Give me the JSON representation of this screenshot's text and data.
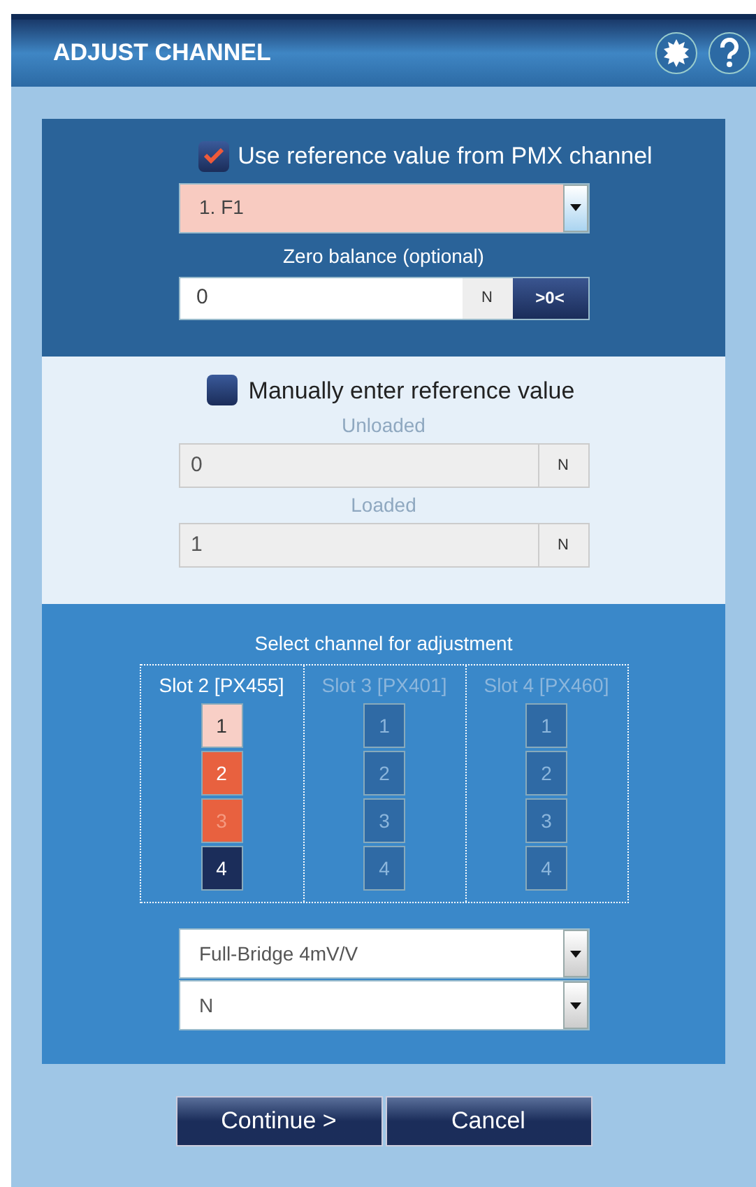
{
  "window": {
    "title": "ADJUST CHANNEL"
  },
  "pmx_section": {
    "checkbox": {
      "label": "Use reference value from PMX channel",
      "checked": true
    },
    "channel_select": {
      "value": "1. F1"
    },
    "zero_balance": {
      "label": "Zero balance (optional)",
      "value": "0",
      "unit": "N",
      "button": ">0<"
    }
  },
  "manual_section": {
    "checkbox": {
      "label": "Manually enter reference value",
      "checked": false
    },
    "fields": [
      {
        "label": "Unloaded",
        "value": "0",
        "unit": "N"
      },
      {
        "label": "Loaded",
        "value": "1",
        "unit": "N"
      }
    ]
  },
  "channel_section": {
    "title": "Select channel for adjustment",
    "slots": [
      {
        "label": "Slot 2 [PX455]",
        "disabled": false,
        "channels": [
          {
            "label": "1",
            "color": "#f8cfc6",
            "disabled": false
          },
          {
            "label": "2",
            "color": "#e8613f",
            "disabled": false
          },
          {
            "label": "3",
            "color": "#e8613f",
            "disabled": true
          },
          {
            "label": "4",
            "color": "#1b2d5a",
            "disabled": false
          }
        ]
      },
      {
        "label": "Slot 3 [PX401]",
        "disabled": true,
        "channels": [
          {
            "label": "1",
            "color": "#2f6aa5",
            "disabled": false
          },
          {
            "label": "2",
            "color": "#2f6aa5",
            "disabled": false
          },
          {
            "label": "3",
            "color": "#2f6aa5",
            "disabled": false
          },
          {
            "label": "4",
            "color": "#2f6aa5",
            "disabled": false
          }
        ]
      },
      {
        "label": "Slot 4 [PX460]",
        "disabled": true,
        "channels": [
          {
            "label": "1",
            "color": "#2f6aa5",
            "disabled": false
          },
          {
            "label": "2",
            "color": "#2f6aa5",
            "disabled": false
          },
          {
            "label": "3",
            "color": "#2f6aa5",
            "disabled": false
          },
          {
            "label": "4",
            "color": "#2f6aa5",
            "disabled": false
          }
        ]
      }
    ],
    "selects": [
      {
        "value": "Full-Bridge 4mV/V"
      },
      {
        "value": "N"
      }
    ]
  },
  "buttons": [
    "Continue >",
    "Cancel"
  ]
}
